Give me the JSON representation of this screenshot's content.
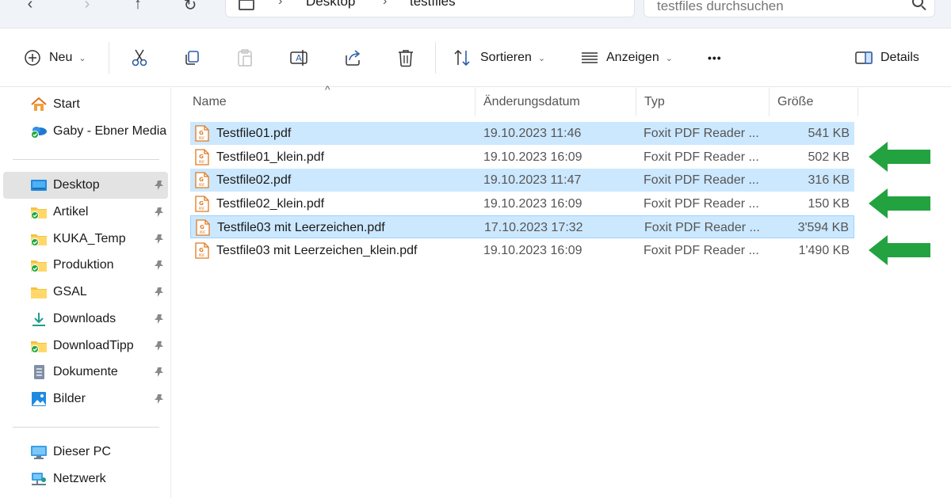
{
  "breadcrumb": [
    "Desktop",
    "testfiles"
  ],
  "search": {
    "placeholder": "testfiles durchsuchen"
  },
  "toolbar": {
    "new_label": "Neu",
    "sort_label": "Sortieren",
    "view_label": "Anzeigen",
    "more_label": "•••",
    "details_label": "Details"
  },
  "sidebar": {
    "top_items": [
      {
        "label": "Start",
        "icon": "home-icon"
      },
      {
        "label": "Gaby - Ebner Media",
        "icon": "onedrive-icon"
      }
    ],
    "pinned_items": [
      {
        "label": "Desktop",
        "icon": "desktop-icon",
        "selected": true
      },
      {
        "label": "Artikel",
        "icon": "folder-icon"
      },
      {
        "label": "KUKA_Temp",
        "icon": "folder-icon"
      },
      {
        "label": "Produktion",
        "icon": "folder-icon"
      },
      {
        "label": "GSAL",
        "icon": "folder-icon"
      },
      {
        "label": "Downloads",
        "icon": "download-icon"
      },
      {
        "label": "DownloadTipp",
        "icon": "folder-icon"
      },
      {
        "label": "Dokumente",
        "icon": "documents-icon"
      },
      {
        "label": "Bilder",
        "icon": "pictures-icon"
      }
    ],
    "bottom_items": [
      {
        "label": "Dieser PC",
        "icon": "pc-icon"
      },
      {
        "label": "Netzwerk",
        "icon": "network-icon"
      }
    ]
  },
  "columns": {
    "name": "Name",
    "date": "Änderungsdatum",
    "type": "Typ",
    "size": "Größe"
  },
  "files": [
    {
      "name": "Testfile01.pdf",
      "date": "19.10.2023 11:46",
      "type": "Foxit PDF Reader ...",
      "size": "541 KB",
      "selected": true
    },
    {
      "name": "Testfile01_klein.pdf",
      "date": "19.10.2023 16:09",
      "type": "Foxit PDF Reader ...",
      "size": "502 KB",
      "selected": false
    },
    {
      "name": "Testfile02.pdf",
      "date": "19.10.2023 11:47",
      "type": "Foxit PDF Reader ...",
      "size": "316 KB",
      "selected": true
    },
    {
      "name": "Testfile02_klein.pdf",
      "date": "19.10.2023 16:09",
      "type": "Foxit PDF Reader ...",
      "size": "150 KB",
      "selected": false
    },
    {
      "name": "Testfile03 mit Leerzeichen.pdf",
      "date": "17.10.2023 17:32",
      "type": "Foxit PDF Reader ...",
      "size": "3'594 KB",
      "selected": true
    },
    {
      "name": "Testfile03 mit Leerzeichen_klein.pdf",
      "date": "19.10.2023 16:09",
      "type": "Foxit PDF Reader ...",
      "size": "1'490 KB",
      "selected": false
    }
  ],
  "colors": {
    "selection": "#cce8ff",
    "arrow": "#22a33f",
    "folder": "#f5c242",
    "sync_ok": "#1ea83a"
  }
}
